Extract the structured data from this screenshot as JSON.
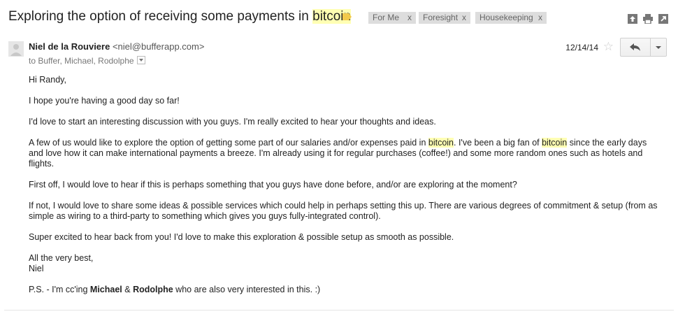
{
  "subject": {
    "before": "Exploring the option of receiving some payments in ",
    "highlight": "bitcoin"
  },
  "labels": [
    {
      "name": "For Me",
      "remove": "x"
    },
    {
      "name": "Foresight",
      "remove": "x"
    },
    {
      "name": "Housekeeping",
      "remove": "x"
    }
  ],
  "top_icons": [
    "open-in-new-window-icon",
    "print-icon",
    "popout-icon"
  ],
  "message": {
    "sender_name": "Niel de la Rouviere",
    "sender_email": "<niel@bufferapp.com>",
    "recipients": "to Buffer, Michael, Rodolphe",
    "date": "12/14/14",
    "star": "☆",
    "body": {
      "greeting": "Hi Randy,",
      "p1": "I hope you're having a good day so far!",
      "p2": "I'd love to start an interesting discussion with you guys. I'm really excited to hear your thoughts and ideas.",
      "p3a": "A few of us would like to explore the option of getting some part of our salaries and/or expenses paid in ",
      "p3_hl1": "bitcoin",
      "p3b": ". I've been a big fan of ",
      "p3_hl2": "bitcoin",
      "p3c": " since the early days and love how it can make international payments a breeze. I'm already using it for regular purchases (coffee!) and some more random ones such as hotels and flights.",
      "p4": "First off, I would love to hear if this is perhaps something that you guys have done before, and/or are exploring at the moment?",
      "p5": "If not, I would love to share some ideas & possible services which could help in perhaps setting this up. There are various degrees of commitment & setup (from as simple as wiring to a third-party to something which gives you guys fully-integrated control).",
      "p6": "Super excited to hear back from you! I'd love to make this exploration & possible setup as smooth as possible.",
      "signoff1": "All the very best,",
      "signoff2": "Niel",
      "ps_a": "P.S. - I'm cc'ing ",
      "ps_michael": "Michael",
      "ps_amp": " & ",
      "ps_rodolphe": "Rodolphe",
      "ps_b": " who are also very interested in this. :)"
    }
  },
  "colors": {
    "highlight": "#ffffb3",
    "label_chip": "#dddddd",
    "label_tag": "#f2c94c"
  }
}
